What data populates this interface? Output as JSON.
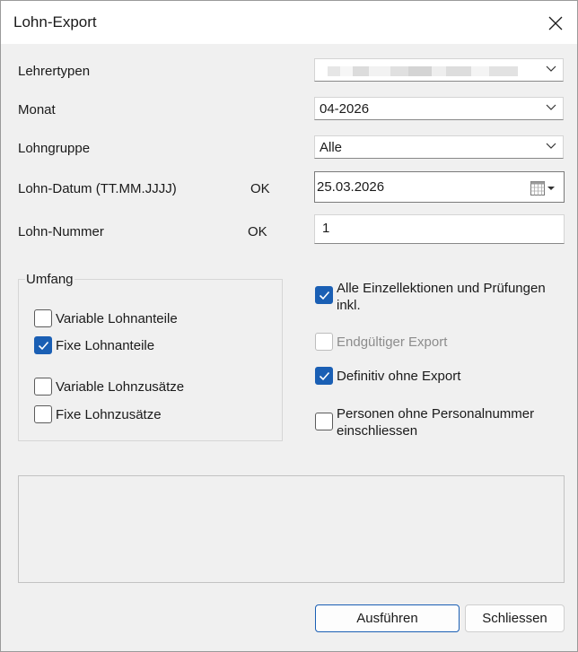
{
  "window": {
    "title": "Lohn-Export"
  },
  "fields": {
    "lehrertypen": {
      "label": "Lehrertypen",
      "value": ""
    },
    "monat": {
      "label": "Monat",
      "value": "04-2026"
    },
    "lohngruppe": {
      "label": "Lohngruppe",
      "value": "Alle"
    },
    "lohn_datum": {
      "label": "Lohn-Datum (TT.MM.JJJJ)",
      "status": "OK",
      "value": "25.03.2026"
    },
    "lohn_nummer": {
      "label": "Lohn-Nummer",
      "status": "OK",
      "value": "1"
    }
  },
  "umfang": {
    "legend": "Umfang",
    "variable_lohnanteile": {
      "label": "Variable Lohnanteile",
      "checked": false
    },
    "fixe_lohnanteile": {
      "label": "Fixe Lohnanteile",
      "checked": true
    },
    "variable_lohnzusaetze": {
      "label": "Variable Lohnzusätze",
      "checked": false
    },
    "fixe_lohnzusaetze": {
      "label": "Fixe Lohnzusätze",
      "checked": false
    }
  },
  "options": {
    "alle_einzellektionen": {
      "label_line1": "Alle Einzellektionen und Prüfungen",
      "label_line2": "inkl.",
      "checked": true
    },
    "endgueltiger_export": {
      "label": "Endgültiger Export",
      "checked": false,
      "disabled": true
    },
    "definitiv_ohne_export": {
      "label": "Definitiv ohne Export",
      "checked": true
    },
    "personen_ohne_personalnummer": {
      "label_line1": "Personen ohne Personalnummer",
      "label_line2": "einschliessen",
      "checked": false
    }
  },
  "buttons": {
    "run": "Ausführen",
    "close": "Schliessen"
  },
  "colors": {
    "accent": "#1a5fb4",
    "window_bg": "#f0f0f0"
  }
}
